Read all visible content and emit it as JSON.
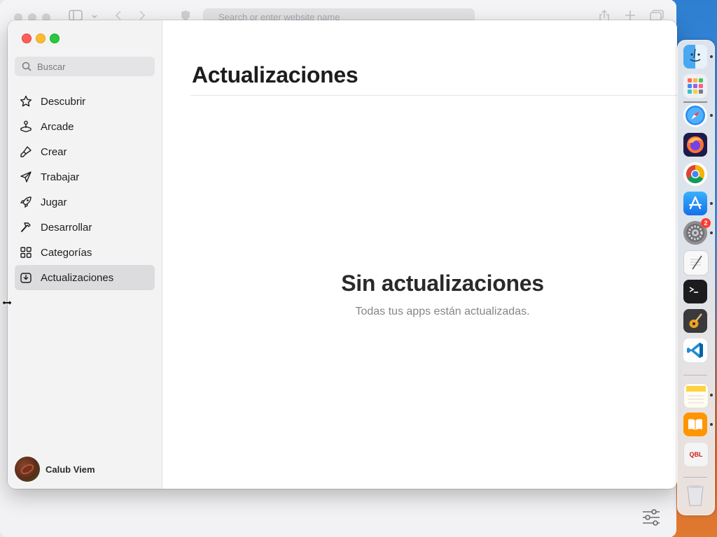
{
  "background_window": {
    "search_placeholder": "Search or enter website name"
  },
  "sidebar": {
    "search": {
      "placeholder": "Buscar",
      "value": ""
    },
    "items": [
      {
        "label": "Descubrir",
        "icon": "star-icon",
        "active": false
      },
      {
        "label": "Arcade",
        "icon": "joystick-icon",
        "active": false
      },
      {
        "label": "Crear",
        "icon": "brush-icon",
        "active": false
      },
      {
        "label": "Trabajar",
        "icon": "paper-plane-icon",
        "active": false
      },
      {
        "label": "Jugar",
        "icon": "rocket-icon",
        "active": false
      },
      {
        "label": "Desarrollar",
        "icon": "hammer-icon",
        "active": false
      },
      {
        "label": "Categorías",
        "icon": "grid-icon",
        "active": false
      },
      {
        "label": "Actualizaciones",
        "icon": "download-box-icon",
        "active": true
      }
    ],
    "user": {
      "name": "Calub Viem"
    }
  },
  "main": {
    "title": "Actualizaciones",
    "empty_state": {
      "title": "Sin actualizaciones",
      "subtitle": "Todas tus apps están actualizadas."
    }
  },
  "dock": {
    "apps": [
      {
        "name": "finder-icon",
        "running": true
      },
      {
        "name": "launchpad-icon",
        "running": false
      },
      {
        "name": "safari-icon",
        "running": true
      },
      {
        "name": "firefox-icon",
        "running": false
      },
      {
        "name": "chrome-icon",
        "running": false
      },
      {
        "name": "app-store-icon",
        "running": true
      },
      {
        "name": "system-settings-icon",
        "running": true,
        "badge": "2"
      },
      {
        "name": "textedit-icon",
        "running": false
      },
      {
        "name": "terminal-icon",
        "running": false
      },
      {
        "name": "garageband-icon",
        "running": false
      },
      {
        "name": "vscode-icon",
        "running": false
      },
      {
        "name": "notes-icon",
        "running": true
      },
      {
        "name": "books-icon",
        "running": true
      },
      {
        "name": "sql-app-icon",
        "running": false
      },
      {
        "name": "trash-icon",
        "running": false
      }
    ],
    "sql_label": "QBL"
  },
  "colors": {
    "accent_active_bg": "#dcdcde",
    "close": "#ff5f57",
    "minimize": "#febc2e",
    "maximize": "#28c840"
  }
}
